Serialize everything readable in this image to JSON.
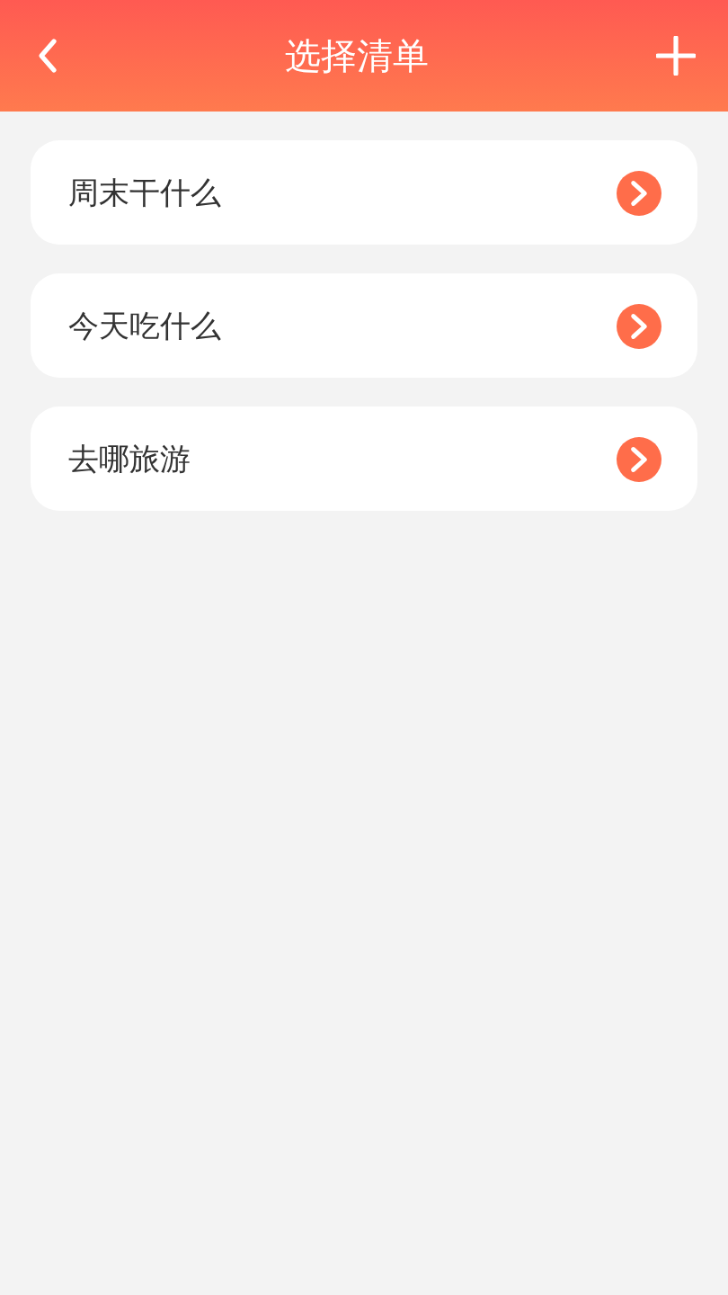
{
  "header": {
    "title": "选择清单"
  },
  "lists": [
    {
      "label": "周末干什么"
    },
    {
      "label": "今天吃什么"
    },
    {
      "label": "去哪旅游"
    }
  ]
}
